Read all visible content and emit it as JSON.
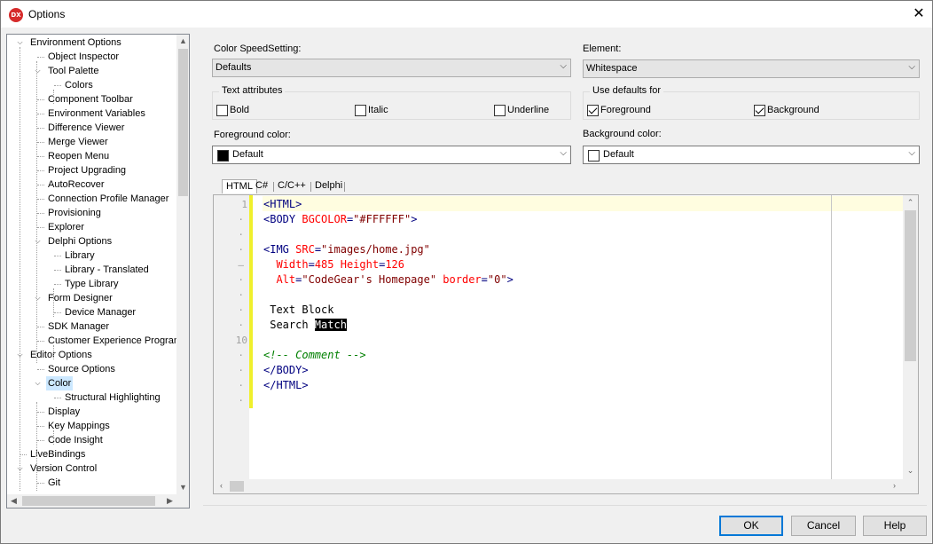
{
  "window": {
    "title": "Options",
    "icon": "DX"
  },
  "tree": {
    "items": [
      {
        "label": "Environment Options",
        "level": 0,
        "expanded": true
      },
      {
        "label": "Object Inspector",
        "level": 1
      },
      {
        "label": "Tool Palette",
        "level": 1,
        "expanded": true
      },
      {
        "label": "Colors",
        "level": 2
      },
      {
        "label": "Component Toolbar",
        "level": 1
      },
      {
        "label": "Environment Variables",
        "level": 1
      },
      {
        "label": "Difference Viewer",
        "level": 1
      },
      {
        "label": "Merge Viewer",
        "level": 1
      },
      {
        "label": "Reopen Menu",
        "level": 1
      },
      {
        "label": "Project Upgrading",
        "level": 1
      },
      {
        "label": "AutoRecover",
        "level": 1
      },
      {
        "label": "Connection Profile Manager",
        "level": 1
      },
      {
        "label": "Provisioning",
        "level": 1
      },
      {
        "label": "Explorer",
        "level": 1
      },
      {
        "label": "Delphi Options",
        "level": 1,
        "expanded": true
      },
      {
        "label": "Library",
        "level": 2
      },
      {
        "label": "Library - Translated",
        "level": 2
      },
      {
        "label": "Type Library",
        "level": 2
      },
      {
        "label": "Form Designer",
        "level": 1,
        "expanded": true
      },
      {
        "label": "Device Manager",
        "level": 2
      },
      {
        "label": "SDK Manager",
        "level": 1
      },
      {
        "label": "Customer Experience Program",
        "level": 1
      },
      {
        "label": "Editor Options",
        "level": 0,
        "expanded": true
      },
      {
        "label": "Source Options",
        "level": 1
      },
      {
        "label": "Color",
        "level": 1,
        "expanded": true,
        "selected": true
      },
      {
        "label": "Structural Highlighting",
        "level": 2
      },
      {
        "label": "Display",
        "level": 1
      },
      {
        "label": "Key Mappings",
        "level": 1
      },
      {
        "label": "Code Insight",
        "level": 1
      },
      {
        "label": "LiveBindings",
        "level": 0
      },
      {
        "label": "Version Control",
        "level": 0,
        "expanded": true
      },
      {
        "label": "Git",
        "level": 1
      }
    ]
  },
  "color_speedsetting": {
    "label": "Color SpeedSetting:",
    "value": "Defaults"
  },
  "element": {
    "label": "Element:",
    "value": "Whitespace"
  },
  "text_attributes": {
    "title": "Text attributes",
    "bold": "Bold",
    "italic": "Italic",
    "underline": "Underline",
    "bold_checked": false,
    "italic_checked": false,
    "underline_checked": false
  },
  "use_defaults": {
    "title": "Use defaults for",
    "foreground": "Foreground",
    "background": "Background",
    "foreground_checked": true,
    "background_checked": true
  },
  "foreground_color": {
    "label": "Foreground color:",
    "value": "Default",
    "swatch": "#000000"
  },
  "background_color": {
    "label": "Background color:",
    "value": "Default",
    "swatch": "#ffffff"
  },
  "editor_tabs": [
    "HTML",
    "C#",
    "C/C++",
    "Delphi"
  ],
  "active_tab": "HTML",
  "gutter": {
    "line1": "1",
    "line10": "10"
  },
  "code_lines": [
    {
      "parts": [
        {
          "t": "<HTML>",
          "c": "t"
        }
      ]
    },
    {
      "parts": [
        {
          "t": "<BODY ",
          "c": "t"
        },
        {
          "t": "BGCOLOR",
          "c": "a"
        },
        {
          "t": "=",
          "c": "t"
        },
        {
          "t": "\"#FFFFFF\"",
          "c": "s"
        },
        {
          "t": ">",
          "c": "t"
        }
      ]
    },
    {
      "parts": []
    },
    {
      "parts": [
        {
          "t": "<IMG ",
          "c": "t"
        },
        {
          "t": "SRC",
          "c": "a"
        },
        {
          "t": "=",
          "c": "t"
        },
        {
          "t": "\"images/home.jpg\"",
          "c": "s"
        }
      ]
    },
    {
      "parts": [
        {
          "t": "  Width",
          "c": "a"
        },
        {
          "t": "=",
          "c": "t"
        },
        {
          "t": "485 ",
          "c": "a"
        },
        {
          "t": "Height",
          "c": "a"
        },
        {
          "t": "=",
          "c": "t"
        },
        {
          "t": "126",
          "c": "a"
        }
      ]
    },
    {
      "parts": [
        {
          "t": "  Alt",
          "c": "a"
        },
        {
          "t": "=",
          "c": "t"
        },
        {
          "t": "\"CodeGear's Homepage\"",
          "c": "s"
        },
        {
          "t": " border",
          "c": "a"
        },
        {
          "t": "=",
          "c": "t"
        },
        {
          "t": "\"0\"",
          "c": "s"
        },
        {
          "t": ">",
          "c": "t"
        }
      ]
    },
    {
      "parts": []
    },
    {
      "parts": [
        {
          "t": " Text Block",
          "c": "n"
        }
      ]
    },
    {
      "parts": [
        {
          "t": " Search ",
          "c": "n"
        },
        {
          "t": "Match",
          "c": "hl"
        }
      ]
    },
    {
      "parts": []
    },
    {
      "parts": [
        {
          "t": "<!-- Comment -->",
          "c": "c"
        }
      ]
    },
    {
      "parts": [
        {
          "t": "</BODY>",
          "c": "t"
        }
      ]
    },
    {
      "parts": [
        {
          "t": "</HTML>",
          "c": "t"
        }
      ]
    }
  ],
  "buttons": {
    "ok": "OK",
    "cancel": "Cancel",
    "help": "Help"
  }
}
